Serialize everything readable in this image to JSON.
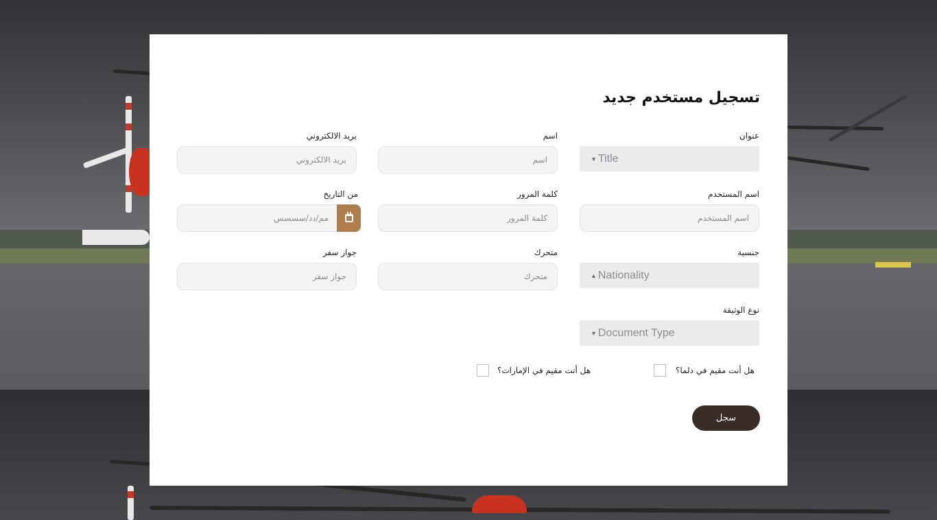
{
  "form": {
    "title": "تسجيل مستخدم جديد",
    "fields": {
      "title": {
        "label": "عنوان",
        "value": "Title"
      },
      "name": {
        "label": "اسم",
        "placeholder": "اسم"
      },
      "email": {
        "label": "بريد الالكتروني",
        "placeholder": "بريد الالكتروني"
      },
      "username": {
        "label": "اسم المستخدم",
        "placeholder": "اسم المستخدم"
      },
      "password": {
        "label": "كلمة المرور",
        "placeholder": "كلمة المرور"
      },
      "from_date": {
        "label": "من التاريخ",
        "placeholder": "مم/دد/سسسس"
      },
      "nationality": {
        "label": "جنسية",
        "value": "Nationality"
      },
      "mobile": {
        "label": "متحرك",
        "placeholder": "متحرك"
      },
      "passport": {
        "label": "جواز سفر",
        "placeholder": "جواز سفر"
      },
      "document_type": {
        "label": "نوع الوثيقة",
        "value": "Document Type"
      }
    },
    "checkboxes": {
      "dalma_resident": "هل أنت مقيم في دلما؟",
      "uae_resident": "هل أنت مقيم في الإمارات؟"
    },
    "submit_label": "سجل"
  },
  "colors": {
    "accent_brown": "#b07d4d",
    "button_dark": "#3a2c26"
  }
}
